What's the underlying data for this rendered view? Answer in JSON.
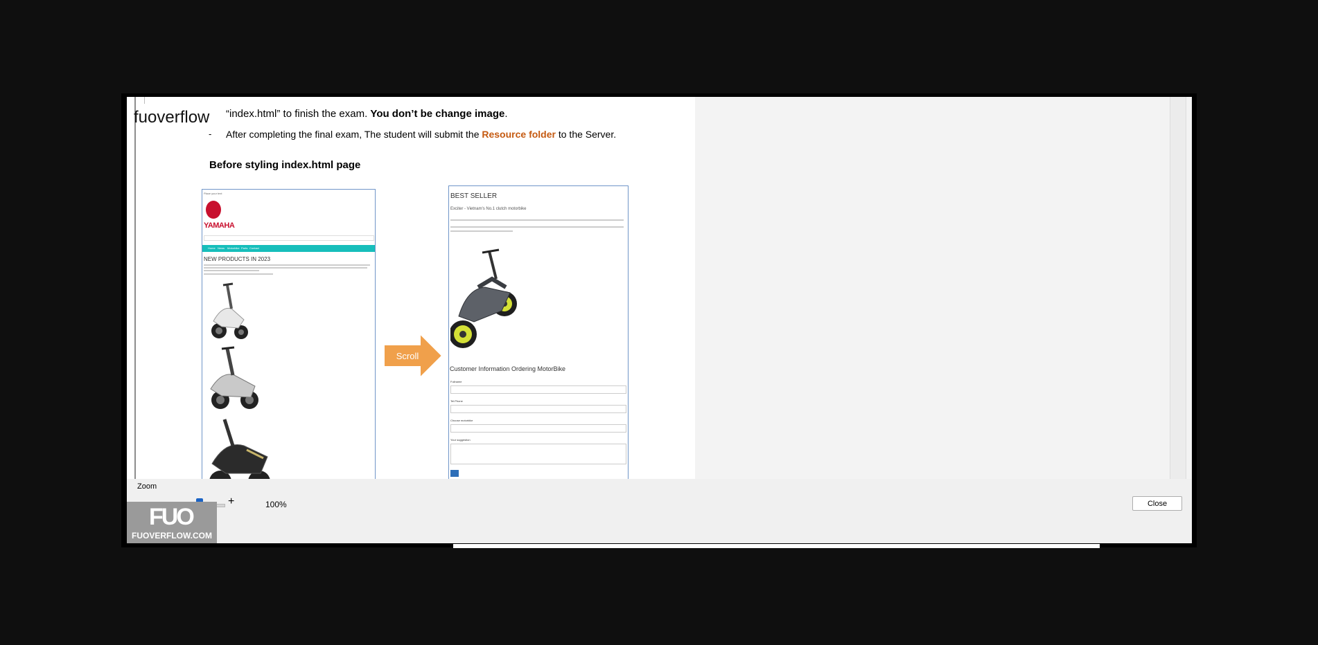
{
  "document": {
    "line1_prefix": "“index.html”  to finish the exam. ",
    "line1_bold": "You don’t be change image",
    "line1_suffix": ".",
    "bullet": "-",
    "line2_prefix": "After completing the final exam, The student will submit the ",
    "line2_highlight": "Resource folder",
    "line2_suffix": " to the Server.",
    "heading": "Before styling index.html page",
    "arrow_label": "Scroll",
    "left_screenshot": {
      "title": "NEW PRODUCTS IN 2023",
      "logo": "YAMAHA",
      "nav_items": [
        "Home",
        "News",
        "Motorbike",
        "Parts",
        "Contact"
      ]
    },
    "right_screenshot": {
      "title": "BEST SELLER",
      "subtitle": "Exciter - Vietnam's No.1 clutch motorbike",
      "form_title": "Customer Information Ordering MotorBike"
    }
  },
  "watermark": {
    "text": "fuoverflow",
    "logo_mark": "FUO",
    "site": "FUOVERFLOW.COM"
  },
  "controls": {
    "zoom_label": "Zoom",
    "minus": "-",
    "plus": "+",
    "zoom_value": "100%",
    "zoom_level_percent": 100,
    "close_label": "Close"
  },
  "colors": {
    "highlight": "#c55a11",
    "nav": "#17bebb",
    "arrow": "#f0a04b",
    "slider_thumb": "#1a63c5"
  }
}
